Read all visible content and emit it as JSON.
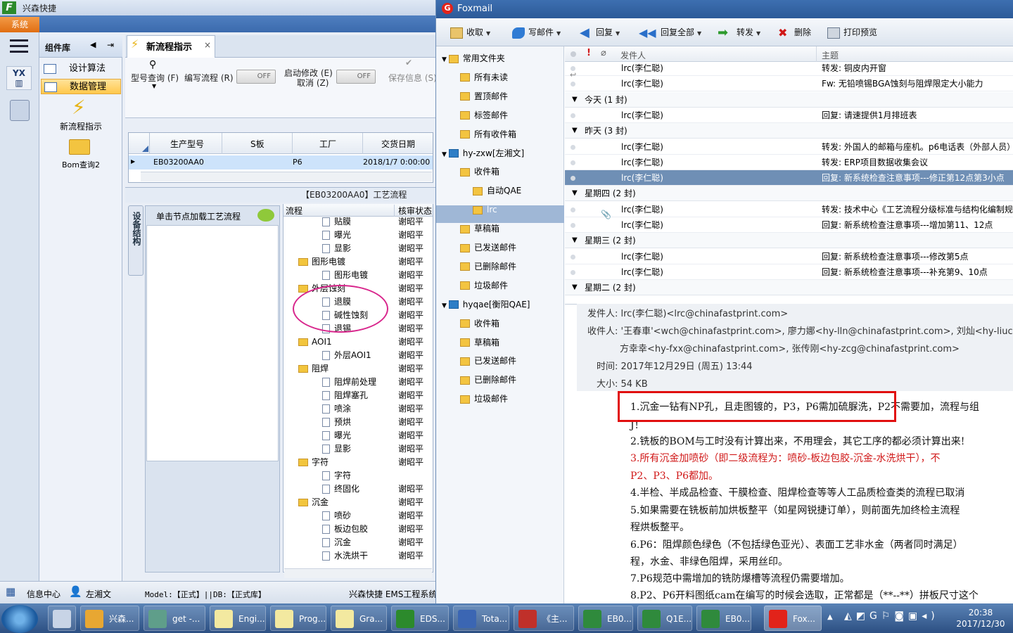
{
  "app": {
    "title": "兴森快捷",
    "menu_system": "系统",
    "component_panel": {
      "title": "组件库",
      "items": [
        "设计算法",
        "数据管理"
      ],
      "new_flow": "新流程指示",
      "bom": "Bom查询2"
    },
    "tab": {
      "label": "新流程指示",
      "close": "×"
    },
    "toolbar": {
      "model_query": "型号查询 (F)",
      "write_flow": "编写流程 (R)",
      "toggle1": "OFF",
      "start_modify": "启动修改 (E)",
      "cancel": "取消 (Z)",
      "toggle2": "OFF",
      "save": "保存信息 (S)"
    },
    "grid": {
      "columns": [
        "生产型号",
        "S板",
        "工厂",
        "交货日期"
      ],
      "row": {
        "model": "EB03200AA0",
        "factory": "P6",
        "date": "2018/1/7 0:00:00"
      }
    },
    "flow_title": "【EB03200AA0】工艺流程",
    "side_tab": "设备结构",
    "node_hint": "单击节点加载工艺流程",
    "tree_head": {
      "flow": "流程",
      "status": "核审状态"
    },
    "tree": [
      {
        "label": "贴膜",
        "type": "doc",
        "status": "谢昭平"
      },
      {
        "label": "曝光",
        "type": "doc",
        "status": "谢昭平"
      },
      {
        "label": "显影",
        "type": "doc",
        "status": "谢昭平"
      },
      {
        "label": "图形电镀",
        "type": "folder",
        "status": "谢昭平"
      },
      {
        "label": "图形电镀",
        "type": "doc",
        "status": "谢昭平"
      },
      {
        "label": "外层蚀刻",
        "type": "folder",
        "status": "谢昭平"
      },
      {
        "label": "退膜",
        "type": "doc",
        "status": "谢昭平"
      },
      {
        "label": "碱性蚀刻",
        "type": "doc",
        "status": "谢昭平"
      },
      {
        "label": "退锡",
        "type": "doc",
        "status": "谢昭平"
      },
      {
        "label": "AOI1",
        "type": "folder",
        "status": "谢昭平"
      },
      {
        "label": "外层AOI1",
        "type": "doc",
        "status": "谢昭平"
      },
      {
        "label": "阻焊",
        "type": "folder",
        "status": "谢昭平"
      },
      {
        "label": "阻焊前处理",
        "type": "doc",
        "status": "谢昭平"
      },
      {
        "label": "阻焊塞孔",
        "type": "doc",
        "status": "谢昭平"
      },
      {
        "label": "喷涂",
        "type": "doc",
        "status": "谢昭平"
      },
      {
        "label": "预烘",
        "type": "doc",
        "status": "谢昭平"
      },
      {
        "label": "曝光",
        "type": "doc",
        "status": "谢昭平"
      },
      {
        "label": "显影",
        "type": "doc",
        "status": "谢昭平"
      },
      {
        "label": "字符",
        "type": "folder",
        "status": "谢昭平"
      },
      {
        "label": "字符",
        "type": "doc",
        "status": ""
      },
      {
        "label": "终固化",
        "type": "doc",
        "status": "谢昭平"
      },
      {
        "label": "沉金",
        "type": "folder",
        "status": "谢昭平"
      },
      {
        "label": "喷砂",
        "type": "doc",
        "status": "谢昭平"
      },
      {
        "label": "板边包胶",
        "type": "doc",
        "status": "谢昭平"
      },
      {
        "label": "沉金",
        "type": "doc",
        "status": "谢昭平"
      },
      {
        "label": "水洗烘干",
        "type": "doc",
        "status": "谢昭平"
      }
    ],
    "status": {
      "info": "信息中心",
      "user": "左湘文",
      "model": "Model:【正式】||DB:【正式库】",
      "right": "兴森快捷 EMS工程系统"
    }
  },
  "foxmail": {
    "title": "Foxmail",
    "toolbar": [
      "收取",
      "写邮件",
      "回复",
      "回复全部",
      "转发",
      "删除",
      "打印预览"
    ],
    "folders": [
      {
        "label": "常用文件夹",
        "level": 0
      },
      {
        "label": "所有未读",
        "level": 1
      },
      {
        "label": "置顶邮件",
        "level": 1
      },
      {
        "label": "标签邮件",
        "level": 1
      },
      {
        "label": "所有收件箱",
        "level": 1
      },
      {
        "label": "hy-zxw[左湘文]",
        "level": 0
      },
      {
        "label": "收件箱",
        "level": 1
      },
      {
        "label": "自动QAE",
        "level": 2
      },
      {
        "label": "lrc",
        "level": 2
      },
      {
        "label": "草稿箱",
        "level": 1
      },
      {
        "label": "已发送邮件",
        "level": 1
      },
      {
        "label": "已删除邮件",
        "level": 1
      },
      {
        "label": "垃圾邮件",
        "level": 1
      },
      {
        "label": "hyqae[衡阳QAE]",
        "level": 0
      },
      {
        "label": "收件箱",
        "level": 1
      },
      {
        "label": "草稿箱",
        "level": 1
      },
      {
        "label": "已发送邮件",
        "level": 1
      },
      {
        "label": "已删除邮件",
        "level": 1
      },
      {
        "label": "垃圾邮件",
        "level": 1
      }
    ],
    "list_head": {
      "flag": "!",
      "from": "发件人",
      "subject": "主题"
    },
    "list": [
      {
        "kind": "row",
        "from": "lrc(李仁聪)",
        "subject": "转发: 铜皮内开窗"
      },
      {
        "kind": "row",
        "from": "lrc(李仁聪)",
        "subject": "Fw: 无铅喷锡BGA蚀刻与阻焊限定大小能力"
      },
      {
        "kind": "group",
        "label": "今天 (1 封)"
      },
      {
        "kind": "row",
        "from": "lrc(李仁聪)",
        "subject": "回复: 请速提供1月排班表"
      },
      {
        "kind": "group",
        "label": "昨天 (3 封)"
      },
      {
        "kind": "row",
        "from": "lrc(李仁聪)",
        "subject": "转发: 外国人的邮箱与座机。p6电话表（外部人员）"
      },
      {
        "kind": "row",
        "from": "lrc(李仁聪)",
        "subject": "转发: ERP项目数据收集会议"
      },
      {
        "kind": "row",
        "from": "lrc(李仁聪)",
        "subject": "回复: 新系统检查注意事项---修正第12点第3小点",
        "selected": true
      },
      {
        "kind": "group",
        "label": "星期四 (2 封)"
      },
      {
        "kind": "row",
        "from": "lrc(李仁聪)",
        "subject": "转发: 技术中心《工艺流程分级标准与结构化编制规"
      },
      {
        "kind": "row",
        "from": "lrc(李仁聪)",
        "subject": "回复: 新系统检查注意事项---增加第11、12点"
      },
      {
        "kind": "group",
        "label": "星期三 (2 封)"
      },
      {
        "kind": "row",
        "from": "lrc(李仁聪)",
        "subject": "回复: 新系统检查注意事项---修改第5点"
      },
      {
        "kind": "row",
        "from": "lrc(李仁聪)",
        "subject": "回复: 新系统检查注意事项---补充第9、10点"
      },
      {
        "kind": "group",
        "label": "星期二 (2 封)"
      }
    ],
    "preview": {
      "from": "发件人: lrc(李仁聪)<lrc@chinafastprint.com>",
      "to": "收件人: '王春車'<wch@chinafastprint.com>, 廖力娜<hy-lln@chinafastprint.com>, 刘灿<hy-liuc@c",
      "to2": "方幸幸<hy-fxx@chinafastprint.com>, 张传刚<hy-zcg@chinafastprint.com>",
      "time": "时间: 2017年12月29日 (周五) 13:44",
      "size": "大小: 54 KB",
      "lines": [
        "1.沉金一钻有NP孔，且走图镀的，P3，P6需加硫脲洗，P2不需要加，流程与组",
        "J！",
        "2.铣板的BOM与工时没有计算出来，不用理会，其它工序的都必须计算出来!",
        "3.所有沉金加喷砂（即二级流程为：喷砂-板边包胶-沉金-水洗烘干），不",
        "P2、P3、P6都加。",
        "4.半检、半成品检查、干膜检查、阻焊检查等等人工品质检查类的流程已取消",
        "5.如果需要在铣板前加烘板整平（如星网锐捷订单），则前面先加终检主流程",
        "程烘板整平。",
        "6.P6：阻焊颜色绿色（不包括绿色亚光）、表面工艺非水金（两者同时满足）",
        "程，水金、非绿色阻焊，采用丝印。",
        "7.P6规范中需增加的铣防爆槽等流程仍需要增加。",
        "8.P2、P6开料图纸cam在编写的时候会选取，正常都是（**--**）拼板尺寸这个"
      ]
    }
  },
  "taskbar": {
    "items": [
      "兴森...",
      "get -...",
      "Engi...",
      "Prog...",
      "Gra...",
      "EDS...",
      "Tota...",
      "《主...",
      "EB0...",
      "Q1E...",
      "EB0...",
      "Fox..."
    ],
    "time": "20:38",
    "date": "2017/12/30"
  },
  "colors": {
    "accent_orange": "#e06e12",
    "foxmail_red": "#e2231a",
    "highlight_box": "#e10f0f",
    "ellipse": "#d8268c"
  }
}
